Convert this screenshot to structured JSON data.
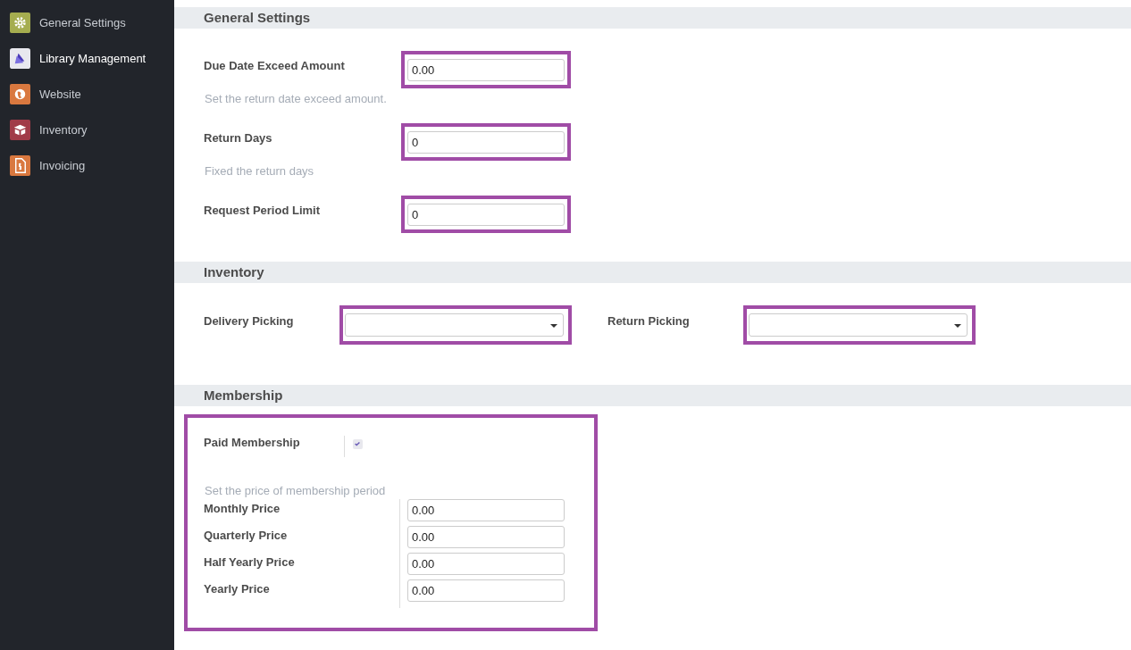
{
  "sidebar": {
    "items": [
      {
        "label": "General Settings",
        "selected": false
      },
      {
        "label": "Library Management",
        "selected": true
      },
      {
        "label": "Website",
        "selected": false
      },
      {
        "label": "Inventory",
        "selected": false
      },
      {
        "label": "Invoicing",
        "selected": false
      }
    ]
  },
  "general_settings": {
    "title": "General Settings",
    "fields": [
      {
        "label": "Due Date Exceed Amount",
        "value": "0.00",
        "help": "Set the return date exceed amount."
      },
      {
        "label": "Return Days",
        "value": "0",
        "help": "Fixed the return days"
      },
      {
        "label": "Request Period Limit",
        "value": "0"
      }
    ]
  },
  "inventory": {
    "title": "Inventory",
    "fields": [
      {
        "label": "Delivery Picking"
      },
      {
        "label": "Return Picking"
      }
    ]
  },
  "membership": {
    "title": "Membership",
    "paid_membership": {
      "label": "Paid Membership",
      "checked": true
    },
    "help": "Set the price of membership period",
    "prices": [
      {
        "label": "Monthly Price",
        "value": "0.00"
      },
      {
        "label": "Quarterly Price",
        "value": "0.00"
      },
      {
        "label": "Half Yearly Price",
        "value": "0.00"
      },
      {
        "label": "Yearly Price",
        "value": "0.00"
      }
    ]
  }
}
